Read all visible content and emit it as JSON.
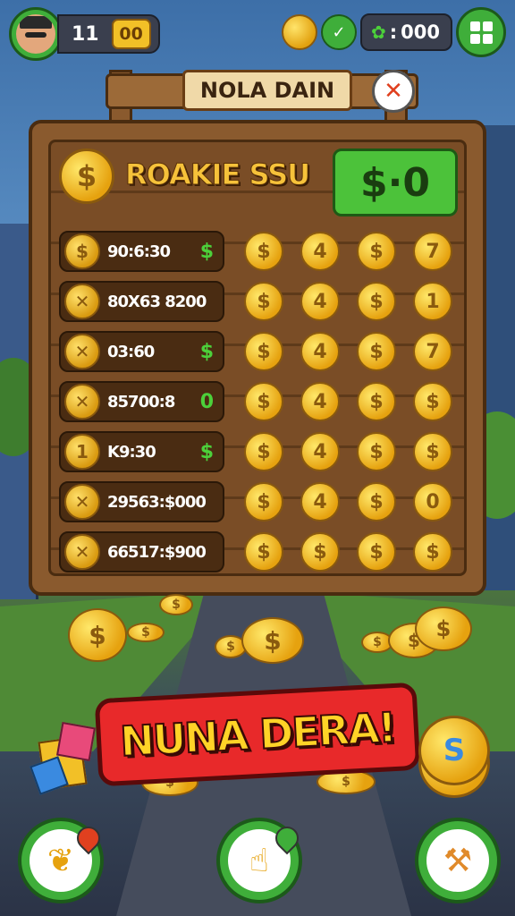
{
  "hud": {
    "level": "11",
    "level_badge": "00",
    "currency": "000",
    "icons": {
      "avatar": "player-avatar",
      "coin": "coin-icon",
      "check": "check-icon",
      "gem": "clover-gem-icon",
      "menu": "grid-menu-icon"
    }
  },
  "board": {
    "title": "NOLA DAIN",
    "close_symbol": "✕",
    "header": {
      "coin_symbol": "$",
      "title": "ROAKIE SSU",
      "value": "$·0"
    },
    "rows": [
      {
        "icon": "$",
        "label": "90:6:30",
        "tag": "$",
        "coins": [
          "$",
          "4",
          "$",
          "7"
        ]
      },
      {
        "icon": "✕",
        "label": "80X63 8200",
        "tag": "",
        "coins": [
          "$",
          "4",
          "$",
          "1"
        ]
      },
      {
        "icon": "✕",
        "label": "03:60",
        "tag": "$",
        "coins": [
          "$",
          "4",
          "$",
          "7"
        ]
      },
      {
        "icon": "✕",
        "label": "85700:8",
        "tag": "0",
        "coins": [
          "$",
          "4",
          "$",
          "$"
        ]
      },
      {
        "icon": "1",
        "label": "K9:30",
        "tag": "$",
        "coins": [
          "$",
          "4",
          "$",
          "$"
        ]
      },
      {
        "icon": "✕",
        "label": "29563:$000",
        "tag": "",
        "coins": [
          "$",
          "4",
          "$",
          "0"
        ]
      },
      {
        "icon": "✕",
        "label": "66517:$900",
        "tag": "",
        "coins": [
          "$",
          "$",
          "$",
          "$"
        ]
      }
    ]
  },
  "banner": {
    "text": "NUNA DERA!"
  },
  "stack": {
    "symbol": "S"
  },
  "colors": {
    "accent_green": "#3fae3a",
    "banner_red": "#e8292a",
    "coin_gold": "#e6a20f",
    "wood": "#8a5a2e"
  },
  "bottom_nav": [
    {
      "name": "map-pin-button",
      "icon": "leaf-pin-icon"
    },
    {
      "name": "hand-button",
      "icon": "hand-point-icon"
    },
    {
      "name": "tools-button",
      "icon": "wrench-icon"
    }
  ]
}
